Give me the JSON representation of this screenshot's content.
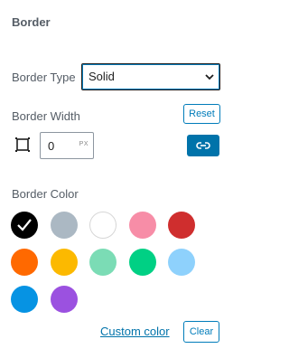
{
  "panel": {
    "title": "Border"
  },
  "border_type": {
    "label": "Border Type",
    "selected": "Solid"
  },
  "border_width": {
    "label": "Border Width",
    "reset_label": "Reset",
    "value": "0",
    "unit": "PX"
  },
  "border_color": {
    "label": "Border Color",
    "selected_index": 0,
    "swatches": [
      {
        "name": "black",
        "color": "#000000"
      },
      {
        "name": "gray",
        "color": "#abb8c3"
      },
      {
        "name": "white",
        "color": "#ffffff"
      },
      {
        "name": "pale-pink",
        "color": "#f78da7"
      },
      {
        "name": "vivid-red",
        "color": "#cf2e2e"
      },
      {
        "name": "luminous-vivid-orange",
        "color": "#ff6900"
      },
      {
        "name": "luminous-vivid-amber",
        "color": "#fcb900"
      },
      {
        "name": "light-green-cyan",
        "color": "#7bdcb5"
      },
      {
        "name": "vivid-green-cyan",
        "color": "#00d084"
      },
      {
        "name": "pale-cyan-blue",
        "color": "#8ed1fc"
      },
      {
        "name": "vivid-cyan-blue",
        "color": "#0693e3"
      },
      {
        "name": "vivid-purple",
        "color": "#9b51e0"
      }
    ],
    "custom_label": "Custom color",
    "clear_label": "Clear"
  },
  "colors": {
    "accent": "#007cba",
    "text": "#555d66"
  }
}
